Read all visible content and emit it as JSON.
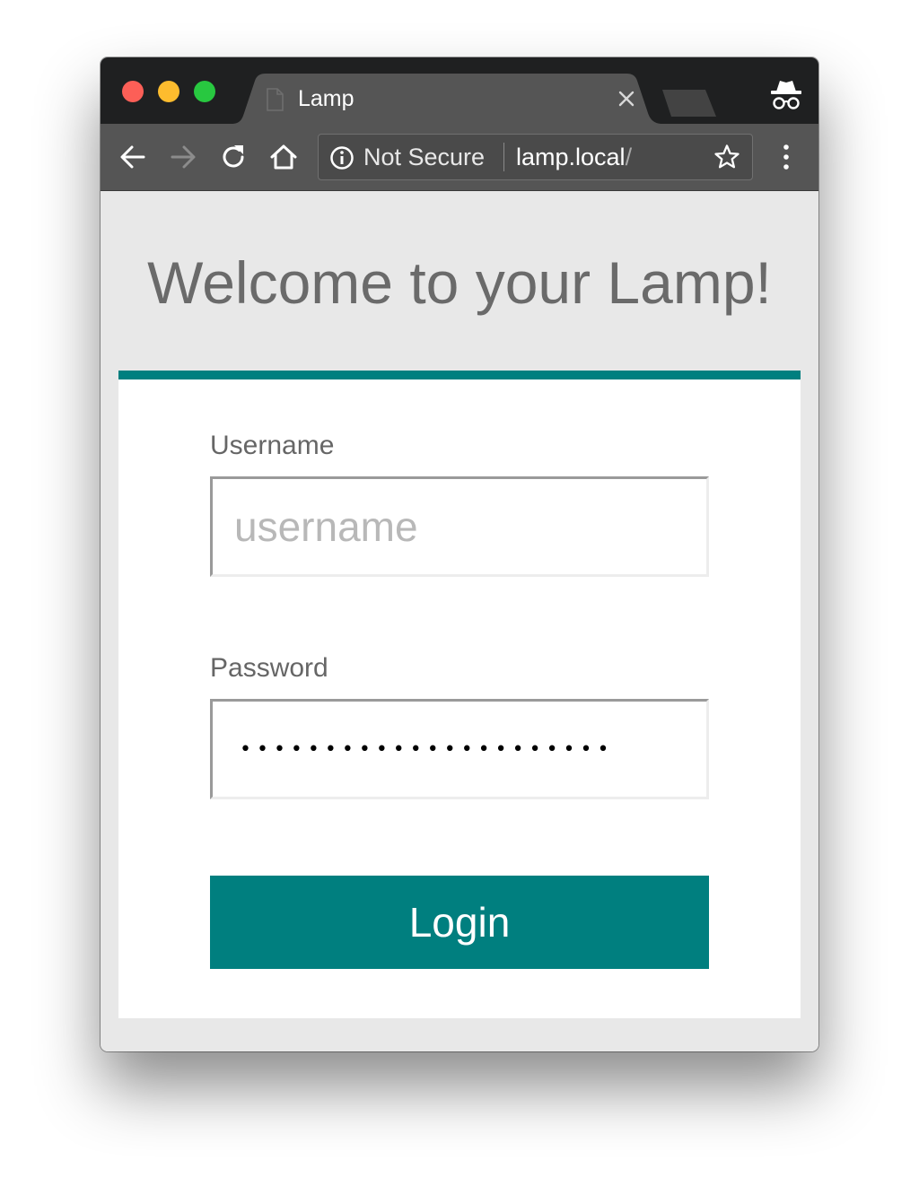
{
  "browser": {
    "tab": {
      "title": "Lamp",
      "close_glyph": "×",
      "icon": "file-icon"
    },
    "toolbar": {
      "back_icon": "arrow-left-icon",
      "forward_icon": "arrow-right-icon",
      "reload_icon": "reload-icon",
      "home_icon": "home-icon",
      "menu_icon": "more-vertical-icon"
    },
    "omnibox": {
      "security_label": "Not Secure",
      "url_host": "lamp.local",
      "url_path": "/",
      "info_icon": "info-icon",
      "bookmark_icon": "star-icon"
    },
    "incognito_icon": "incognito-icon",
    "traffic_lights": {
      "close": "#fc5f57",
      "minimize": "#fdbc2e",
      "maximize": "#28c840"
    }
  },
  "page": {
    "heading": "Welcome to your Lamp!",
    "form": {
      "username_label": "Username",
      "username_placeholder": "username",
      "username_value": "",
      "password_label": "Password",
      "password_value": "••••••••••••••••••••••",
      "submit_label": "Login"
    }
  },
  "colors": {
    "accent": "#007f7f",
    "page_background": "#e8e8e8",
    "heading_text": "#6a6a6a"
  }
}
